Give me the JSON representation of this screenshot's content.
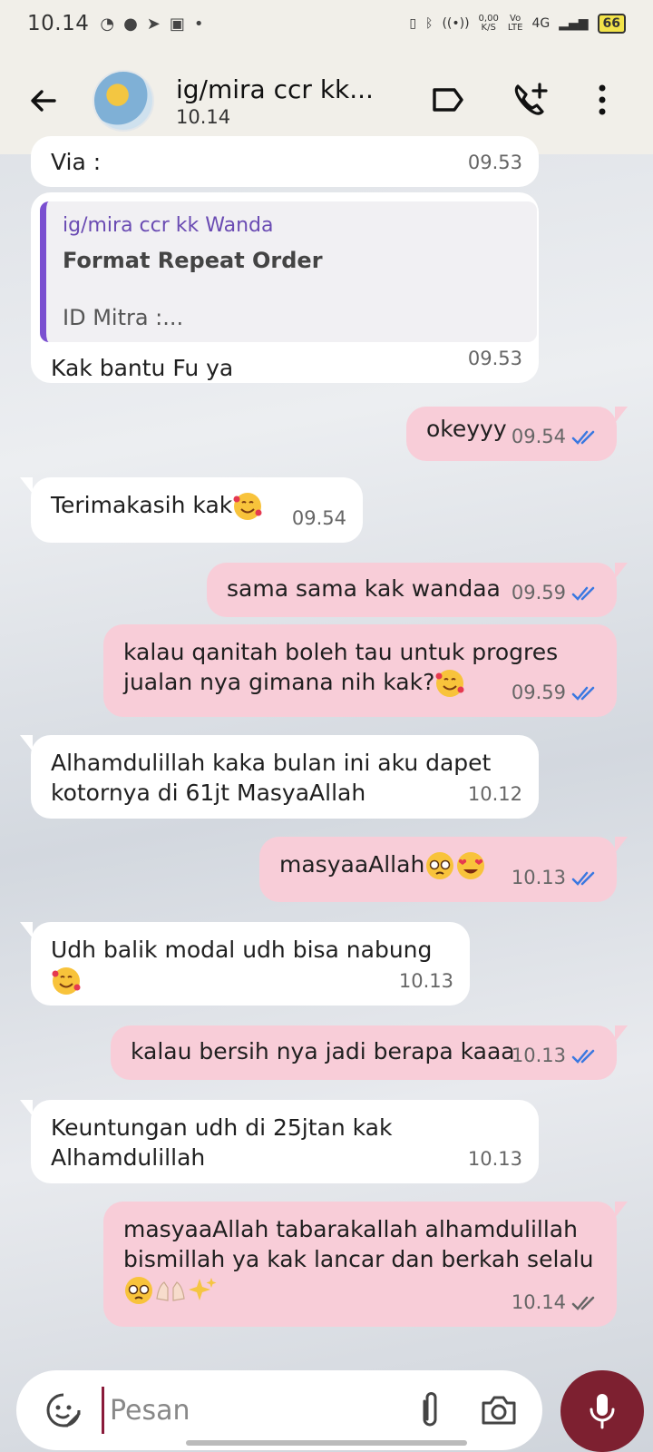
{
  "status_bar": {
    "time": "10.14",
    "net_speed": "0,00",
    "net_unit": "K/S",
    "volte_top": "Vo",
    "volte_bottom": "LTE",
    "network": "4G",
    "battery": "66"
  },
  "header": {
    "contact_name": "ig/mira ccr kk...",
    "last_seen": "10.14"
  },
  "messages": [
    {
      "dir": "in",
      "text": "Via :",
      "time": "09.53"
    },
    {
      "dir": "in",
      "quote_author": "ig/mira ccr kk Wanda",
      "quote_title": "Format Repeat Order",
      "quote_body": "ID Mitra :...",
      "text": "Kak bantu Fu ya",
      "time": "09.53"
    },
    {
      "dir": "out",
      "text": "okeyyy",
      "time": "09.54",
      "status": "read"
    },
    {
      "dir": "in",
      "text": "Terimakasih kak",
      "emoji": "smiling-face-with-hearts",
      "time": "09.54"
    },
    {
      "dir": "out",
      "text": "sama sama kak wandaa",
      "time": "09.59",
      "status": "read"
    },
    {
      "dir": "out",
      "line1": "kalau qanitah boleh tau untuk progres",
      "line2": "jualan nya gimana nih kak?",
      "emoji": "smiling-face-with-hearts",
      "time": "09.59",
      "status": "read"
    },
    {
      "dir": "in",
      "line1": "Alhamdulillah kaka bulan ini aku dapet",
      "line2": "kotornya di 61jt MasyaAllah",
      "time": "10.12"
    },
    {
      "dir": "out",
      "text": "masyaaAllah",
      "emoji": "pleading-face heart-eyes",
      "time": "10.13",
      "status": "read"
    },
    {
      "dir": "in",
      "text": "Udh balik modal udh bisa nabung",
      "emoji": "smiling-face-with-hearts",
      "time": "10.13"
    },
    {
      "dir": "out",
      "text": "kalau bersih nya jadi berapa kaaa",
      "time": "10.13",
      "status": "read"
    },
    {
      "dir": "in",
      "line1": "Keuntungan udh di 25jtan kak",
      "line2": "Alhamdulillah",
      "time": "10.13"
    },
    {
      "dir": "out",
      "line1": "masyaaAllah tabarakallah alhamdulillah",
      "line2": "bismillah ya kak lancar dan berkah selalu",
      "emoji": "pleading-face palms-up sparkles",
      "time": "10.14",
      "status": "delivered"
    }
  ],
  "input": {
    "placeholder": "Pesan"
  },
  "colors": {
    "outgoing": "#f8cdd8",
    "incoming": "#ffffff",
    "read_ticks": "#3a78e0",
    "mic_button": "#7d2030",
    "quote_bar": "#7a4fd0"
  }
}
